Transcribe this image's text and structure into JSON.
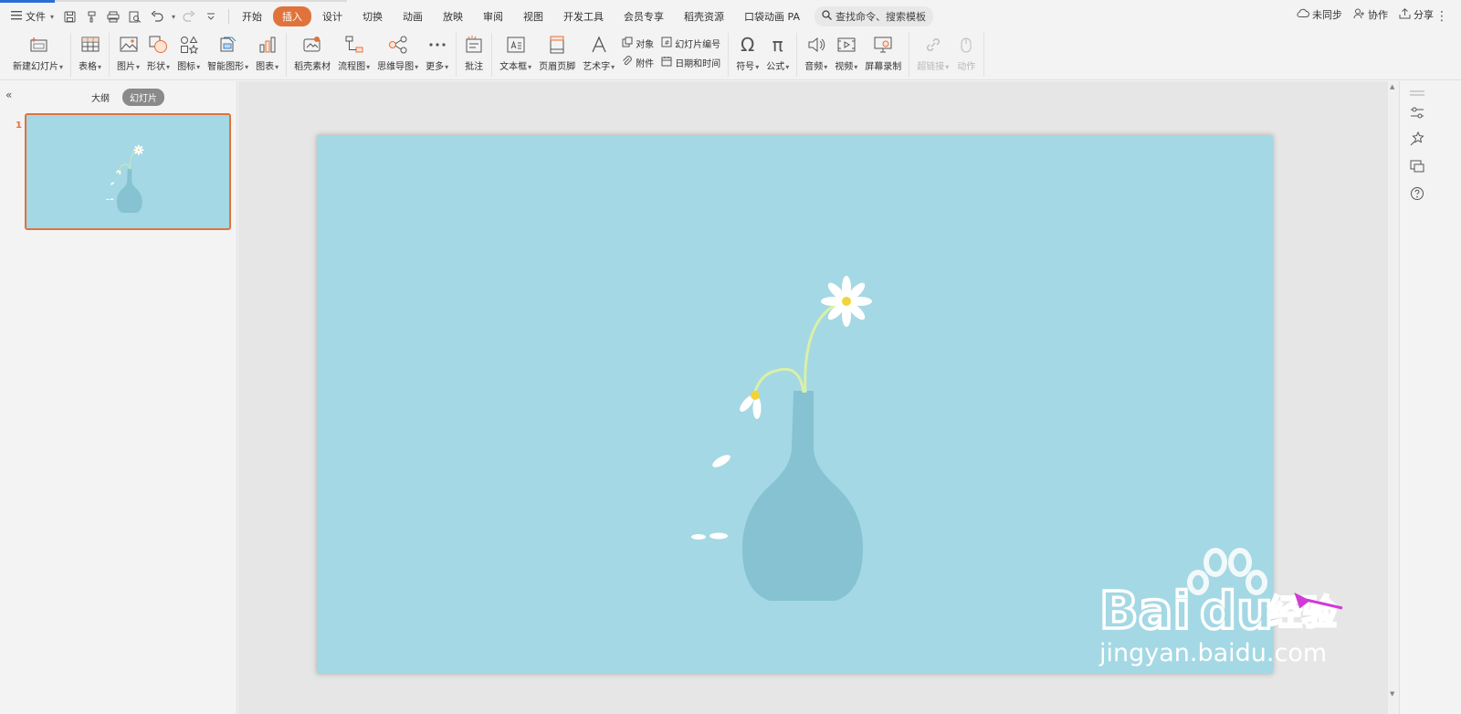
{
  "menu": {
    "file_label": "文件",
    "tabs": [
      {
        "label": "开始"
      },
      {
        "label": "插入",
        "active": true
      },
      {
        "label": "设计"
      },
      {
        "label": "切换"
      },
      {
        "label": "动画"
      },
      {
        "label": "放映"
      },
      {
        "label": "审阅"
      },
      {
        "label": "视图"
      },
      {
        "label": "开发工具"
      },
      {
        "label": "会员专享"
      },
      {
        "label": "稻壳资源"
      },
      {
        "label": "口袋动画 PA"
      }
    ],
    "search_placeholder": "查找命令、搜索模板",
    "sync_label": "未同步",
    "collab_label": "协作",
    "share_label": "分享",
    "accent_color": "#e0733c"
  },
  "ribbon": {
    "new_slide": "新建幻灯片",
    "table": "表格",
    "picture": "图片",
    "shape": "形状",
    "icon": "图标",
    "smartart": "智能图形",
    "chart": "图表",
    "docer_material": "稻壳素材",
    "flowchart": "流程图",
    "mindmap": "思维导图",
    "more": "更多",
    "comment": "批注",
    "textbox": "文本框",
    "header_footer": "页眉页脚",
    "wordart": "艺术字",
    "object": "对象",
    "attachment": "附件",
    "slide_number": "幻灯片编号",
    "date_time": "日期和时间",
    "symbol": "符号",
    "formula": "公式",
    "audio": "音频",
    "video": "视频",
    "screen_record": "屏幕录制",
    "hyperlink": "超链接",
    "action": "动作"
  },
  "leftpanel": {
    "outline_tab": "大纲",
    "slides_tab": "幻灯片",
    "slide_number": "1"
  },
  "slide": {
    "background_color": "#a4d8e4",
    "vase_color": "#86c2d2",
    "stem_color": "#d9f0a8",
    "petal_color": "#ffffff",
    "center_color": "#f2d43a"
  },
  "watermark": {
    "brand_text": "Bai",
    "brand_text2": "du",
    "brand_cn": "经验",
    "site": "jingyan.baidu.com"
  }
}
